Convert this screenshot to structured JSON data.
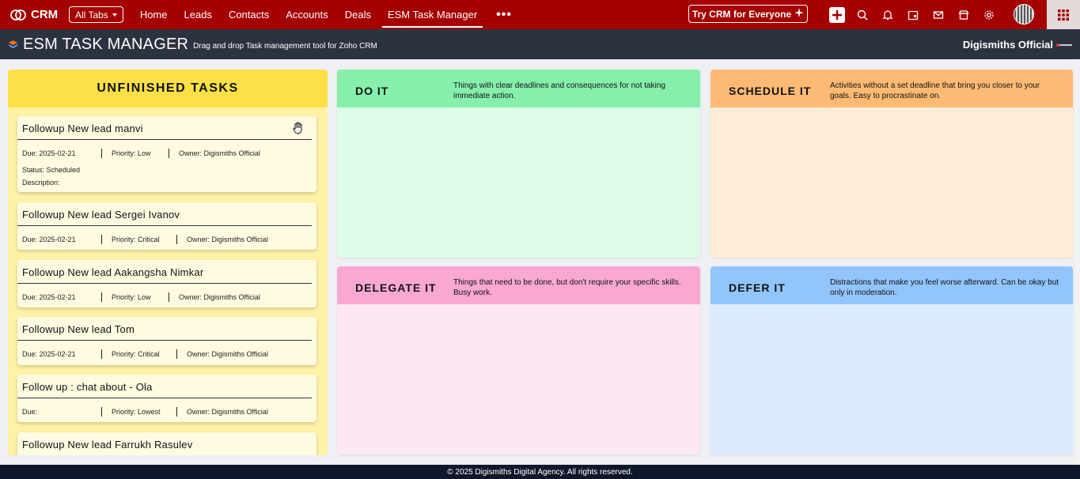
{
  "nav": {
    "brand": "CRM",
    "all_tabs": "All Tabs",
    "tabs": [
      {
        "label": "Home"
      },
      {
        "label": "Leads"
      },
      {
        "label": "Contacts"
      },
      {
        "label": "Accounts"
      },
      {
        "label": "Deals"
      },
      {
        "label": "ESM Task Manager",
        "active": true
      }
    ],
    "more": "•••",
    "try_button": "Try CRM for Everyone",
    "icons": [
      "plus-icon",
      "search-icon",
      "bell-icon",
      "calendar-icon",
      "mail-icon",
      "store-icon",
      "gear-icon",
      "avatar",
      "apps-grid-icon"
    ],
    "accent_color": "#a50000"
  },
  "app": {
    "title": "ESM TASK MANAGER",
    "subtitle": "Drag and drop Task management tool for Zoho CRM",
    "user": "Digismiths Official"
  },
  "unfinished": {
    "heading": "UNFINISHED TASKS",
    "tasks": [
      {
        "title": "Followup New lead manvi",
        "due": "Due: 2025-02-21",
        "priority": "Priority: Low",
        "owner": "Owner: Digismiths Official",
        "status": "Status: Scheduled",
        "description": "Description:"
      },
      {
        "title": "Followup New lead Sergei Ivanov",
        "due": "Due: 2025-02-21",
        "priority": "Priority: Critical",
        "owner": "Owner: Digismiths Official"
      },
      {
        "title": "Followup New lead Aakangsha Nimkar",
        "due": "Due: 2025-02-21",
        "priority": "Priority: Low",
        "owner": "Owner: Digismiths Official"
      },
      {
        "title": "Followup New lead Tom",
        "due": "Due: 2025-02-21",
        "priority": "Priority: Critical",
        "owner": "Owner: Digismiths Official"
      },
      {
        "title": "Follow up : chat about - Ola",
        "due": "Due:",
        "priority": "Priority: Lowest",
        "owner": "Owner: Digismiths Official"
      },
      {
        "title": "Followup New lead Farrukh Rasulev"
      }
    ]
  },
  "quadrants": {
    "do": {
      "title": "DO IT",
      "desc": "Things with clear deadlines and consequences for not taking immediate action.",
      "color": "#86efac"
    },
    "schedule": {
      "title": "SCHEDULE IT",
      "desc": "Activities without a set deadline that bring you closer to your goals. Easy to procrastinate on.",
      "color": "#fdba74"
    },
    "delegate": {
      "title": "DELEGATE IT",
      "desc": "Things that need to be done, but don't require your specific skills. Busy work.",
      "color": "#f9a8d4"
    },
    "defer": {
      "title": "DEFER IT",
      "desc": "Distractions that make you feel worse afterward. Can be okay but only in moderation.",
      "color": "#93c5fd"
    }
  },
  "footer": {
    "text": "© 2025 Digismiths Digital Agency. All rights reserved."
  }
}
